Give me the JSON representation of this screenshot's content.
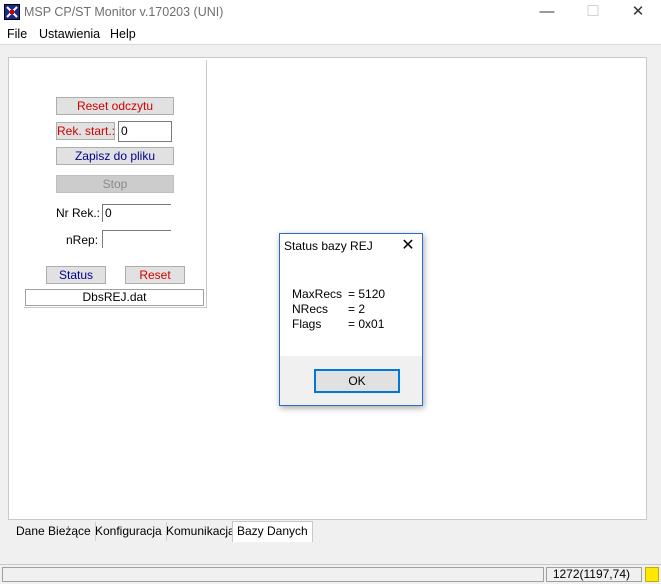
{
  "window": {
    "title": "MSP CP/ST Monitor v.170203 (UNI)",
    "controls": {
      "minimize": "—",
      "maximize": "☐",
      "close": "✕"
    }
  },
  "menu": [
    "File",
    "Ustawienia",
    "Help"
  ],
  "panel": {
    "reset_odczytu": "Reset odczytu",
    "rek_start_label": "Rek. start.:",
    "rek_start_value": "0",
    "zapisz_do_pliku": "Zapisz do pliku",
    "stop": "Stop",
    "nr_rek_label": "Nr Rek.:",
    "nr_rek_value": "0",
    "nrep_label": "nRep:",
    "nrep_value": "",
    "status_button": "Status",
    "reset_button": "Reset",
    "filename": "DbsREJ.dat"
  },
  "dialog": {
    "title": "Status bazy REJ",
    "close": "✕",
    "rows": [
      {
        "key": "MaxRecs",
        "value": "= 5120"
      },
      {
        "key": "NRecs",
        "value": "= 2"
      },
      {
        "key": "Flags",
        "value": "= 0x01"
      }
    ],
    "ok": "OK"
  },
  "tabs": [
    "Dane Bieżące",
    "Konfiguracja",
    "Komunikacja",
    "Bazy Danych"
  ],
  "active_tab": "Bazy Danych",
  "statusbar": {
    "coords": "1272(1197,74)",
    "indicator_color": "#ffe800"
  },
  "icons": {
    "app": "app-icon",
    "close": "close-icon",
    "minimize": "minimize-icon",
    "maximize": "maximize-icon"
  }
}
